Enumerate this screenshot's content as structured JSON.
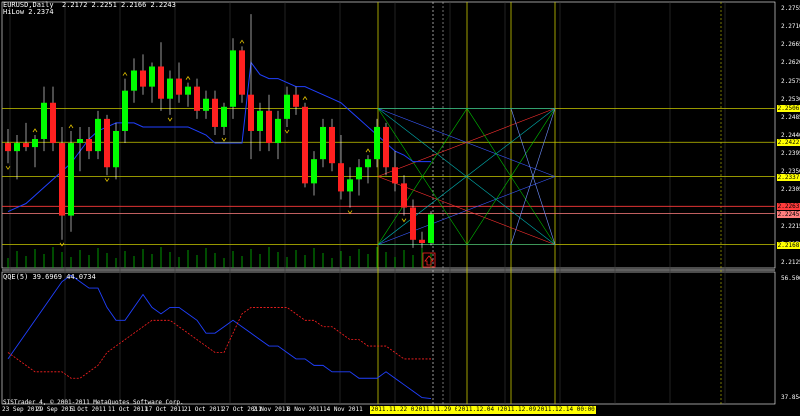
{
  "header": {
    "symbol_line": "EURUSD,Daily  2.2172 2.2251 2.2166 2.2243",
    "indicator_line": "HiLow 2.2374"
  },
  "sub_header": "QQE(5) 39.6969 44.0734",
  "copyright": "SISTrader 4, © 2001-2011 MetaQuotes Software Corp.",
  "price_axis": {
    "ticks": [
      "2.2755",
      "2.2710",
      "2.2665",
      "2.2620",
      "2.2575",
      "2.2530",
      "2.2485",
      "2.2440",
      "2.2395",
      "2.2350",
      "2.2305",
      "2.2260",
      "2.2215",
      "2.2170",
      "2.2125"
    ],
    "labels": [
      {
        "text": "2.2506",
        "bg": "#ffff00"
      },
      {
        "text": "2.2422",
        "bg": "#ffff00"
      },
      {
        "text": "2.2337",
        "bg": "#ffff00"
      },
      {
        "text": "2.2263",
        "bg": "#ff3b3b"
      },
      {
        "text": "2.2245",
        "bg": "#ff7f7f"
      },
      {
        "text": "2.2168",
        "bg": "#ffff00"
      }
    ]
  },
  "sub_axis": {
    "ticks": [
      "56.5067",
      "37.8545"
    ]
  },
  "date_axis": {
    "labels": [
      {
        "text": "23 Sep 2011",
        "hl": false
      },
      {
        "text": "29 Sep 2011",
        "hl": false
      },
      {
        "text": "5 Oct 2011",
        "hl": false
      },
      {
        "text": "11 Oct 2011",
        "hl": false
      },
      {
        "text": "17 Oct 2011",
        "hl": false
      },
      {
        "text": "21 Oct 2011",
        "hl": false
      },
      {
        "text": "27 Oct 2011",
        "hl": false
      },
      {
        "text": "2 Nov 2011",
        "hl": false
      },
      {
        "text": "8 Nov 2011",
        "hl": false
      },
      {
        "text": "14 Nov 2011",
        "hl": false
      },
      {
        "text": "2011.11.22 00:00",
        "hl": true
      },
      {
        "text": "2011.11.29 00:00",
        "hl": true
      },
      {
        "text": "2011.12.04 00:00",
        "hl": true
      },
      {
        "text": "2011.12.09 00:00",
        "hl": true
      },
      {
        "text": "2011.12.14 00:00",
        "hl": true
      }
    ]
  },
  "chart_data": {
    "type": "candlestick",
    "candles": [
      {
        "o": 2.242,
        "h": 2.2455,
        "l": 2.237,
        "c": 2.24
      },
      {
        "o": 2.24,
        "h": 2.244,
        "l": 2.233,
        "c": 2.242
      },
      {
        "o": 2.242,
        "h": 2.247,
        "l": 2.24,
        "c": 2.241
      },
      {
        "o": 2.241,
        "h": 2.244,
        "l": 2.236,
        "c": 2.243
      },
      {
        "o": 2.243,
        "h": 2.256,
        "l": 2.24,
        "c": 2.252
      },
      {
        "o": 2.252,
        "h": 2.256,
        "l": 2.24,
        "c": 2.242
      },
      {
        "o": 2.242,
        "h": 2.246,
        "l": 2.218,
        "c": 2.224
      },
      {
        "o": 2.224,
        "h": 2.245,
        "l": 2.22,
        "c": 2.242
      },
      {
        "o": 2.242,
        "h": 2.246,
        "l": 2.235,
        "c": 2.243
      },
      {
        "o": 2.243,
        "h": 2.246,
        "l": 2.238,
        "c": 2.24
      },
      {
        "o": 2.24,
        "h": 2.25,
        "l": 2.238,
        "c": 2.248
      },
      {
        "o": 2.248,
        "h": 2.249,
        "l": 2.234,
        "c": 2.236
      },
      {
        "o": 2.236,
        "h": 2.247,
        "l": 2.233,
        "c": 2.245
      },
      {
        "o": 2.245,
        "h": 2.258,
        "l": 2.242,
        "c": 2.255
      },
      {
        "o": 2.255,
        "h": 2.263,
        "l": 2.252,
        "c": 2.26
      },
      {
        "o": 2.26,
        "h": 2.264,
        "l": 2.254,
        "c": 2.256
      },
      {
        "o": 2.256,
        "h": 2.262,
        "l": 2.252,
        "c": 2.261
      },
      {
        "o": 2.261,
        "h": 2.267,
        "l": 2.25,
        "c": 2.253
      },
      {
        "o": 2.253,
        "h": 2.26,
        "l": 2.249,
        "c": 2.258
      },
      {
        "o": 2.258,
        "h": 2.262,
        "l": 2.252,
        "c": 2.254
      },
      {
        "o": 2.254,
        "h": 2.257,
        "l": 2.251,
        "c": 2.256
      },
      {
        "o": 2.256,
        "h": 2.258,
        "l": 2.248,
        "c": 2.25
      },
      {
        "o": 2.25,
        "h": 2.255,
        "l": 2.248,
        "c": 2.253
      },
      {
        "o": 2.253,
        "h": 2.255,
        "l": 2.244,
        "c": 2.246
      },
      {
        "o": 2.246,
        "h": 2.252,
        "l": 2.244,
        "c": 2.251
      },
      {
        "o": 2.251,
        "h": 2.268,
        "l": 2.248,
        "c": 2.265
      },
      {
        "o": 2.265,
        "h": 2.266,
        "l": 2.252,
        "c": 2.254
      },
      {
        "o": 2.254,
        "h": 2.274,
        "l": 2.238,
        "c": 2.245
      },
      {
        "o": 2.245,
        "h": 2.252,
        "l": 2.24,
        "c": 2.25
      },
      {
        "o": 2.25,
        "h": 2.254,
        "l": 2.24,
        "c": 2.242
      },
      {
        "o": 2.242,
        "h": 2.25,
        "l": 2.238,
        "c": 2.248
      },
      {
        "o": 2.248,
        "h": 2.256,
        "l": 2.246,
        "c": 2.254
      },
      {
        "o": 2.254,
        "h": 2.256,
        "l": 2.249,
        "c": 2.251
      },
      {
        "o": 2.251,
        "h": 2.252,
        "l": 2.231,
        "c": 2.232
      },
      {
        "o": 2.232,
        "h": 2.24,
        "l": 2.229,
        "c": 2.238
      },
      {
        "o": 2.238,
        "h": 2.248,
        "l": 2.236,
        "c": 2.246
      },
      {
        "o": 2.246,
        "h": 2.248,
        "l": 2.235,
        "c": 2.237
      },
      {
        "o": 2.237,
        "h": 2.244,
        "l": 2.228,
        "c": 2.23
      },
      {
        "o": 2.23,
        "h": 2.236,
        "l": 2.226,
        "c": 2.233
      },
      {
        "o": 2.233,
        "h": 2.238,
        "l": 2.229,
        "c": 2.236
      },
      {
        "o": 2.236,
        "h": 2.239,
        "l": 2.232,
        "c": 2.238
      },
      {
        "o": 2.238,
        "h": 2.248,
        "l": 2.236,
        "c": 2.246
      },
      {
        "o": 2.246,
        "h": 2.247,
        "l": 2.234,
        "c": 2.236
      },
      {
        "o": 2.236,
        "h": 2.24,
        "l": 2.23,
        "c": 2.232
      },
      {
        "o": 2.232,
        "h": 2.234,
        "l": 2.224,
        "c": 2.226
      },
      {
        "o": 2.226,
        "h": 2.228,
        "l": 2.216,
        "c": 2.218
      },
      {
        "o": 2.218,
        "h": 2.22,
        "l": 2.216,
        "c": 2.2172
      },
      {
        "o": 2.2172,
        "h": 2.2251,
        "l": 2.2166,
        "c": 2.2243
      }
    ],
    "hilow_line": [
      2.225,
      2.226,
      2.227,
      2.229,
      2.231,
      2.233,
      2.235,
      2.237,
      2.24,
      2.243,
      2.245,
      2.246,
      2.247,
      2.247,
      2.247,
      2.246,
      2.246,
      2.246,
      2.246,
      2.246,
      2.246,
      2.245,
      2.244,
      2.242,
      2.242,
      2.242,
      2.242,
      2.262,
      2.259,
      2.258,
      2.258,
      2.257,
      2.256,
      2.256,
      2.255,
      2.254,
      2.253,
      2.252,
      2.25,
      2.248,
      2.246,
      2.244,
      2.242,
      2.24,
      2.239,
      2.2374,
      2.2374,
      2.2374
    ],
    "horizontal_levels": [
      2.2506,
      2.2422,
      2.2337,
      2.2263,
      2.2245,
      2.2168
    ],
    "price_range": [
      2.211,
      2.277
    ],
    "qqe_fast": [
      44,
      46,
      48,
      50,
      52,
      54,
      56,
      57,
      56,
      55,
      55,
      52,
      50,
      50,
      52,
      54,
      52,
      51,
      52,
      52,
      51,
      50,
      48,
      48,
      49,
      50,
      49,
      48,
      47,
      46,
      46,
      45,
      44,
      44,
      43,
      43,
      42,
      42,
      42,
      41,
      41,
      41,
      42,
      41,
      40,
      39,
      38,
      37.85
    ],
    "qqe_slow": [
      45,
      44,
      43,
      42,
      42,
      42,
      42,
      41,
      41,
      42,
      43,
      45,
      46,
      47,
      48,
      49,
      50,
      50,
      50,
      49,
      48,
      47,
      46,
      45,
      45,
      48,
      51,
      52,
      52,
      52,
      52,
      52,
      51,
      50,
      50,
      49,
      49,
      48,
      47,
      47,
      46,
      46,
      46,
      45,
      44,
      44,
      44,
      44
    ],
    "qqe_range": [
      37.0,
      57.5
    ],
    "arrows_up": [
      3,
      7,
      13,
      20,
      26,
      33,
      40
    ],
    "arrows_down": [
      0,
      6,
      11,
      18,
      24,
      31,
      38,
      44
    ]
  }
}
